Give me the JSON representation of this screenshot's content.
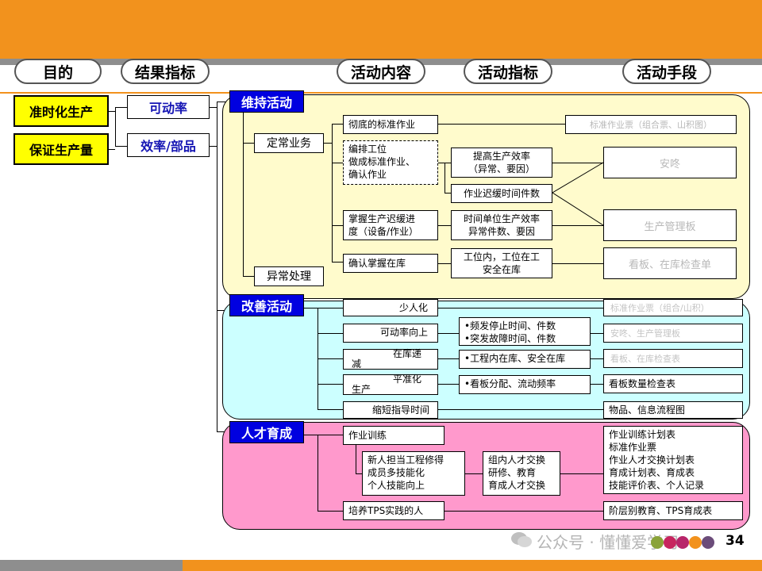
{
  "headers": {
    "purpose": "目的",
    "result_kpi": "结果指标",
    "activity_content": "活动内容",
    "activity_kpi": "活动指标",
    "activity_means": "活动手段"
  },
  "purposes": [
    "准时化生产",
    "保证生产量"
  ],
  "result_kpis": [
    "可动率",
    "效率/部品"
  ],
  "maintain": {
    "title": "维持活动",
    "routine": "定常业务",
    "abnormal": "异常处理",
    "contents": [
      "彻底的标准作业",
      "编排工位\n做成标准作业、\n确认作业",
      "掌握生产迟缓进\n度（设备/作业）",
      "确认掌握在库"
    ],
    "kpis": [
      "提高生产效率\n（异常、要因）",
      "作业迟缓时间件数",
      "时间单位生产效率\n异常件数、要因",
      "工位内，工位在工\n安全在库"
    ],
    "means": [
      "标准作业票（组合票、山积图）",
      "安咚",
      "生产管理板",
      "看板、在库检查单"
    ]
  },
  "improve": {
    "title": "改善活动",
    "contents": [
      "少人化",
      "可动率向上",
      "在库递",
      "减",
      "平准化",
      "生产",
      "缩短指导时间"
    ],
    "kpis": [
      "•频发停止时间、件数\n•突发故障时间、件数",
      "•工程内在库、安全在库",
      "•看板分配、流动频率"
    ],
    "means": [
      "标准作业票（组合/山积）",
      "安咚、生产管理板",
      "看板、在库检查表",
      "看板数量检查表",
      "物品、信息流程图"
    ]
  },
  "talent": {
    "title": "人才育成",
    "contents": [
      "作业训练",
      "新人担当工程修得\n成员多技能化\n个人技能向上",
      "培养TPS实践的人"
    ],
    "kpis": [
      "组内人才交换\n研修、教育\n育成人才交换"
    ],
    "means": [
      "作业训练计划表\n标准作业票\n作业人才交换计划表\n育成计划表、育成表\n技能评价表、个人记录",
      "阶层别教育、TPS育成表"
    ]
  },
  "watermark": "公众号 · 懂懂爱学习",
  "page_number": "34",
  "colors": {
    "orange": "#f2921d",
    "gray": "#8e8e8e",
    "yellow_region": "#fffbcc",
    "cyan_region": "#ccffff",
    "pink_region": "#ff99cc",
    "header_blue": "#0000e0",
    "purpose_yellow": "#ffff00"
  }
}
